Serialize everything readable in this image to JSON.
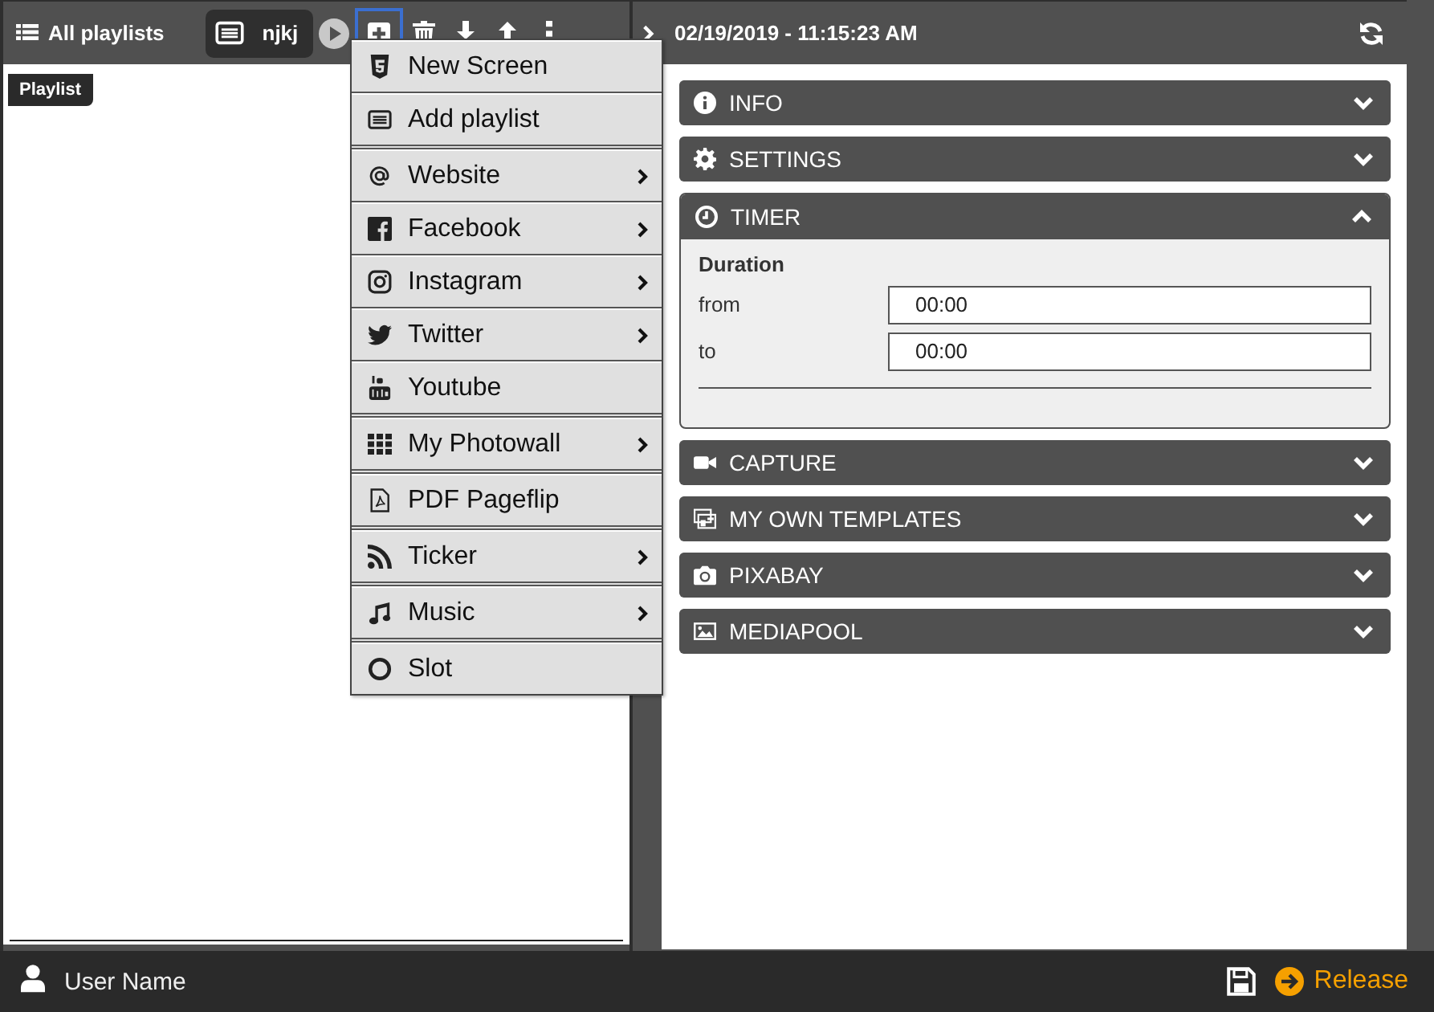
{
  "toolbar": {
    "all_playlists": "All playlists",
    "playlist_tab": {
      "label": "njkj",
      "selected": true
    },
    "buttons": [
      {
        "selected": false
      },
      {
        "selected": true
      },
      {
        "selected": false
      },
      {
        "selected": false
      },
      {
        "selected": false
      },
      {
        "selected": false
      }
    ]
  },
  "left_panel": {
    "tooltip": "Playlist"
  },
  "add_menu": {
    "items": [
      {
        "label": "New Screen",
        "submenu": false
      },
      {
        "label": "Add playlist",
        "submenu": false
      },
      {
        "label": "Website",
        "submenu": true
      },
      {
        "label": "Facebook",
        "submenu": true
      },
      {
        "label": "Instagram",
        "submenu": true
      },
      {
        "label": "Twitter",
        "submenu": true
      },
      {
        "label": "Youtube",
        "submenu": false
      },
      {
        "label": "My Photowall",
        "submenu": true
      },
      {
        "label": "PDF Pageflip",
        "submenu": false
      },
      {
        "label": "Ticker",
        "submenu": true
      },
      {
        "label": "Music",
        "submenu": true
      },
      {
        "label": "Slot",
        "submenu": false
      }
    ]
  },
  "right_panel": {
    "timestamp": "02/19/2019 - 11:15:23 AM",
    "sections": [
      {
        "title": "INFO",
        "expanded": false
      },
      {
        "title": "SETTINGS",
        "expanded": false
      },
      {
        "title": "TIMER",
        "expanded": true,
        "heading": "Duration",
        "fields": [
          {
            "label": "from",
            "value": "00:00"
          },
          {
            "label": "to",
            "value": "00:00"
          }
        ]
      },
      {
        "title": "CAPTURE",
        "expanded": false
      },
      {
        "title": "MY OWN TEMPLATES",
        "expanded": false
      },
      {
        "title": "PIXABAY",
        "expanded": false
      },
      {
        "title": "MEDIAPOOL",
        "expanded": false
      }
    ]
  },
  "status_bar": {
    "user": "User Name",
    "release": "Release"
  }
}
